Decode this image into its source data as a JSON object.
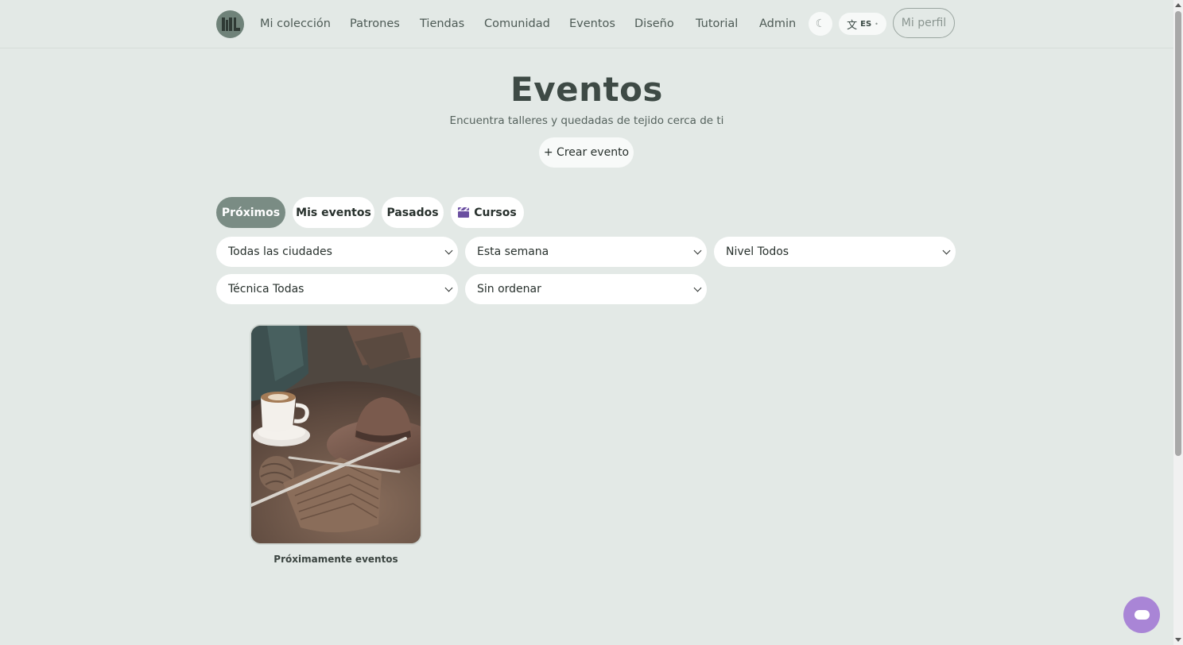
{
  "nav": {
    "items": [
      "Mi colección",
      "Patrones",
      "Tiendas",
      "Comunidad",
      "Eventos",
      "Diseño",
      "Tutorial",
      "Admin"
    ],
    "theme_icon": "☾",
    "lang_icon": "文",
    "lang_code": "ES",
    "lang_caret": "•",
    "profile": "Mi perfil"
  },
  "hero": {
    "title": "Eventos",
    "subtitle": "Encuentra talleres y quedadas de tejido cerca de ti",
    "create_button": "+ Crear evento"
  },
  "tabs": [
    {
      "label": "Próximos",
      "active": true
    },
    {
      "label": "Mis eventos",
      "active": false
    },
    {
      "label": "Pasados",
      "active": false
    },
    {
      "label": "Cursos",
      "active": false,
      "icon": "clapperboard-icon"
    }
  ],
  "filters": {
    "city": "Todas las ciudades",
    "date": "Esta semana",
    "level": "Nivel Todos",
    "technique": "Técnica Todas",
    "sort": "Sin ordenar"
  },
  "cards": [
    {
      "caption": "Próximamente eventos",
      "image": "knitting-coffee-photo"
    }
  ],
  "colors": {
    "background": "#e3e9e6",
    "accent": "#7a8c84",
    "chat": "#a985d6"
  }
}
